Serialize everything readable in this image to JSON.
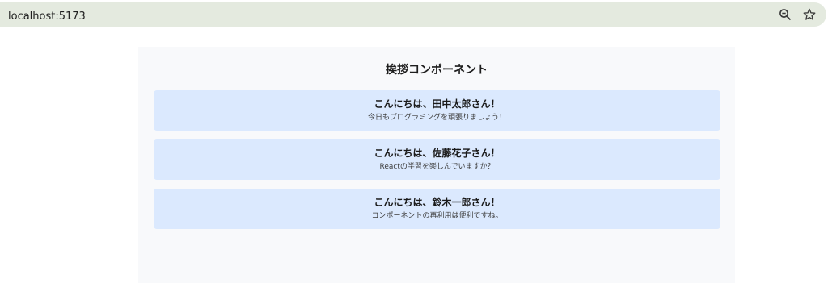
{
  "browser": {
    "url": "localhost:5173",
    "icons": {
      "site_info": "info-icon",
      "zoom": "zoom-out-icon",
      "bookmark": "star-icon"
    }
  },
  "main": {
    "title": "挨拶コンポーネント",
    "cards": [
      {
        "name": "こんにちは、田中太郎さん！",
        "message": "今日もプログラミングを頑張りましょう！"
      },
      {
        "name": "こんにちは、佐藤花子さん！",
        "message": "Reactの学習を楽しんでいますか？"
      },
      {
        "name": "こんにちは、鈴木一郎さん！",
        "message": "コンポーネントの再利用は便利ですね。"
      }
    ]
  },
  "colors": {
    "omnibox": "#e4eadf",
    "panel": "#f8f9fb",
    "card": "#dbe9fe"
  }
}
